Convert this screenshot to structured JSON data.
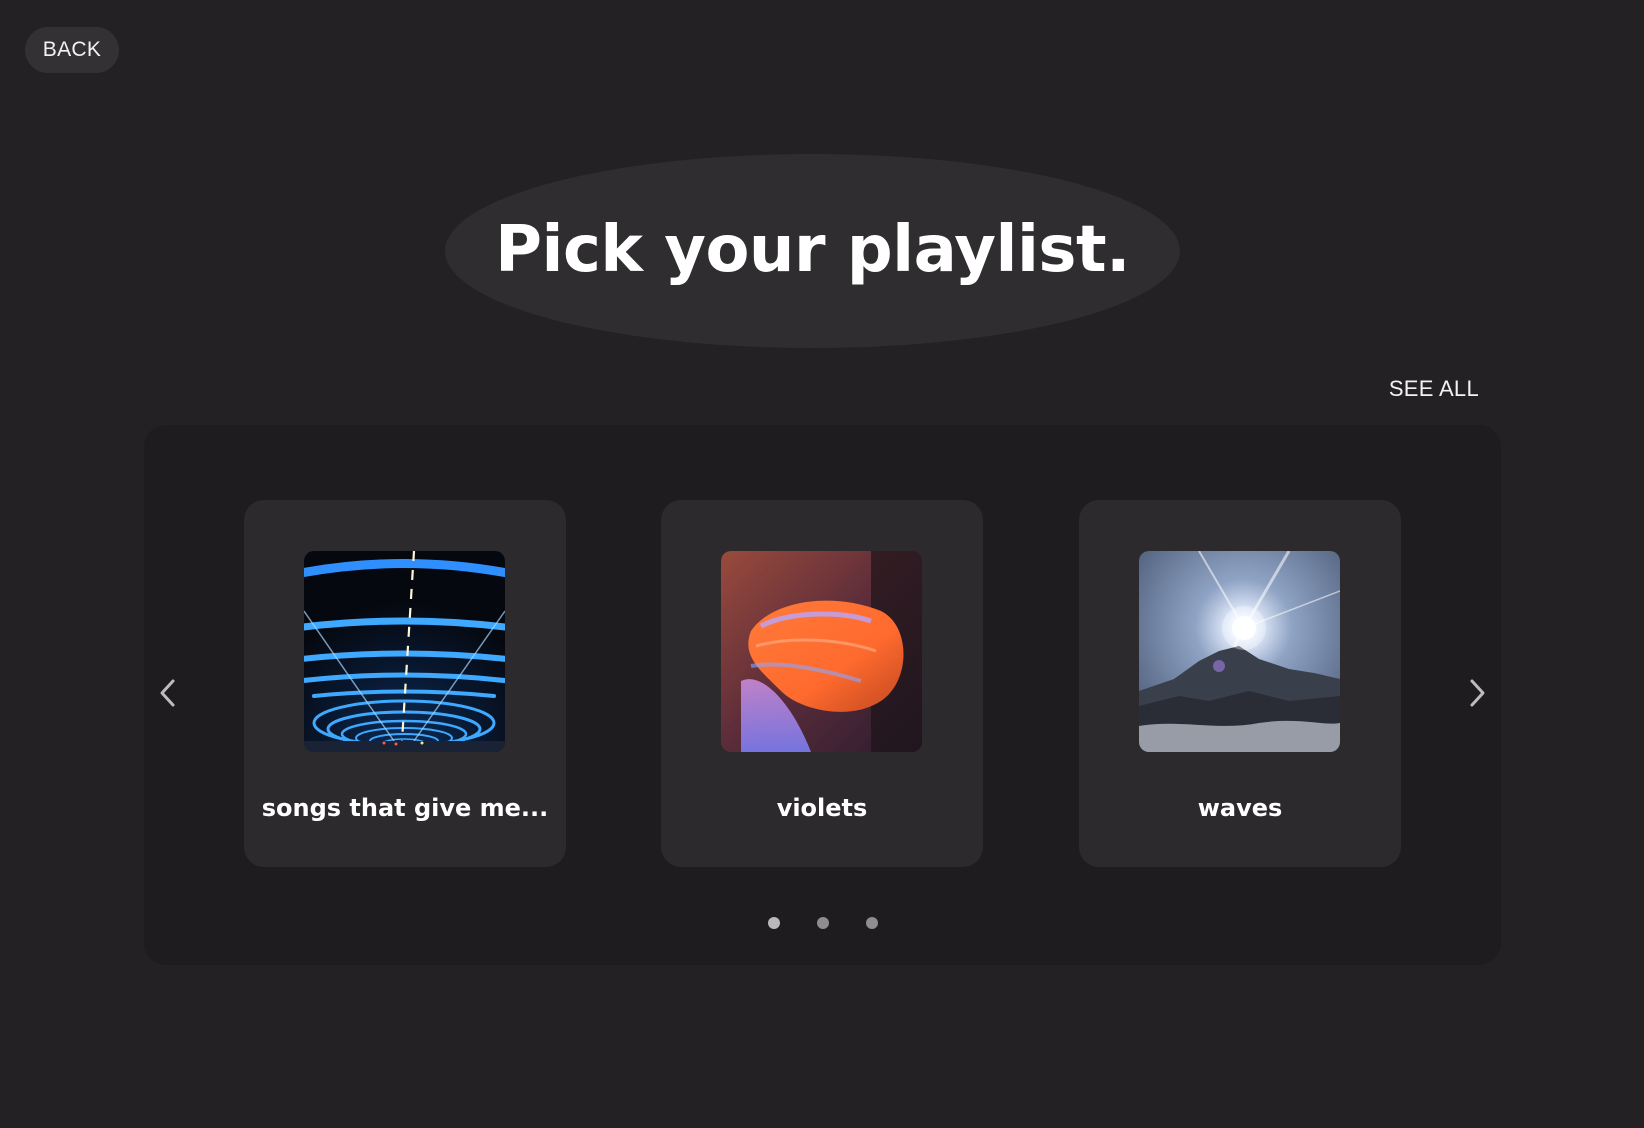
{
  "back_label": "BACK",
  "title": "Pick your playlist.",
  "see_all_label": "SEE ALL",
  "carousel": {
    "prev_icon": "chevron-left-icon",
    "next_icon": "chevron-right-icon",
    "playlists": [
      {
        "name": "songs that give me...",
        "cover": "neon-tunnel-image"
      },
      {
        "name": "violets",
        "cover": "blurred-hand-image"
      },
      {
        "name": "waves",
        "cover": "sun-over-mountains-image"
      }
    ],
    "page_count": 3,
    "active_page": 1
  },
  "colors": {
    "background": "#232123",
    "title_blob": "#2f2d2f",
    "carousel_panel": "#1e1c1e",
    "card": "#2c2a2c",
    "text": "#ffffff"
  }
}
